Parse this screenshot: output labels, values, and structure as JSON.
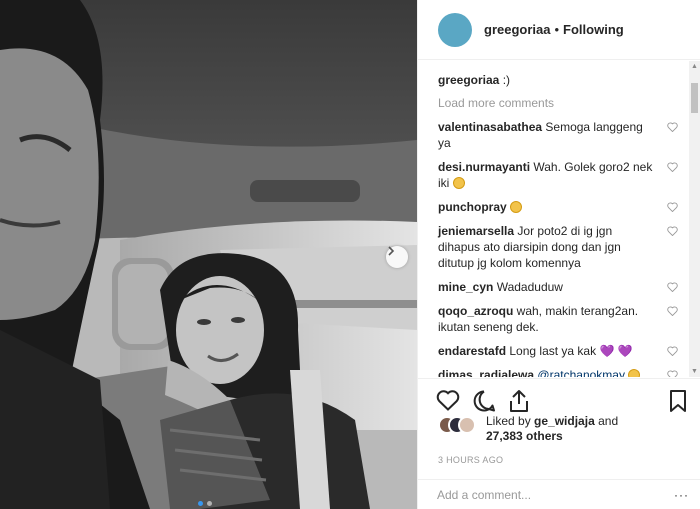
{
  "header": {
    "username": "greegoriaa",
    "separator": "•",
    "follow_status": "Following",
    "avatar_color": "#5aa7c4"
  },
  "caption": {
    "username": "greegoriaa",
    "text": ":)"
  },
  "load_more": "Load more comments",
  "comments": [
    {
      "user": "valentinasabathea",
      "text": "Semoga langgeng ya"
    },
    {
      "user": "desi.nurmayanti",
      "text": "Wah. Golek goro2 nek iki",
      "emoji": "worried-face"
    },
    {
      "user": "punchopray",
      "text": "",
      "emoji": "crying-face"
    },
    {
      "user": "jeniemarsella",
      "text": "Jor poto2 di ig jgn dihapus ato diarsipin dong dan jgn ditutup jg kolom komennya"
    },
    {
      "user": "mine_cyn",
      "text": "Wadaduduw"
    },
    {
      "user": "qoqo_azroqu",
      "text": "wah, makin terang2an. ikutan seneng dek."
    },
    {
      "user": "endarestafd",
      "text": "Long last ya kak",
      "suffix": "💜 💜"
    },
    {
      "user": "dimas_radjalewa",
      "mention": "@ratchanokmay",
      "emoji": "grinning-face"
    },
    {
      "user": "",
      "text": "❤❤❤❤❤"
    }
  ],
  "icons": {
    "like": "heart-outline-icon",
    "comment": "speech-bubble-icon",
    "share": "share-upload-icon",
    "save": "bookmark-icon",
    "next": "chevron-right-icon",
    "more": "more-options-icon"
  },
  "likes": {
    "prefix": "Liked by",
    "user": "ge_widjaja",
    "and": "and",
    "count": "27,383 others"
  },
  "timestamp": "3 HOURS AGO",
  "add_comment_placeholder": "Add a comment...",
  "more_label": "···",
  "carousel": {
    "slides": 2,
    "active": 0,
    "active_color": "#3897f0"
  }
}
